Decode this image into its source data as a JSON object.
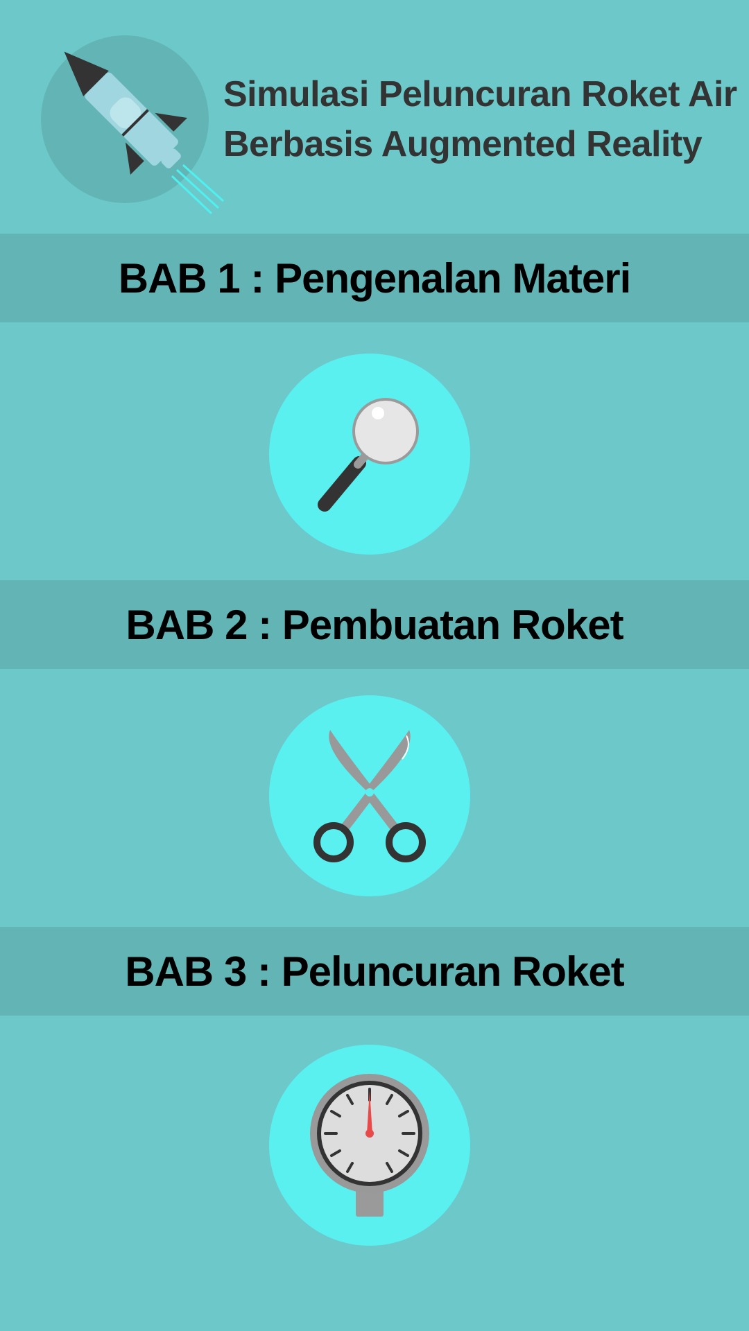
{
  "header": {
    "title_line1": "Simulasi Peluncuran Roket Air",
    "title_line2": "Berbasis Augmented Reality",
    "logo_icon": "water-rocket-icon"
  },
  "chapters": [
    {
      "label": "BAB 1 : Pengenalan Materi",
      "icon": "magnifying-glass-icon"
    },
    {
      "label": "BAB 2 : Pembuatan Roket",
      "icon": "scissors-icon"
    },
    {
      "label": "BAB 3 : Peluncuran Roket",
      "icon": "pressure-gauge-icon"
    }
  ],
  "colors": {
    "background": "#6dc9c9",
    "band": "#63b5b5",
    "icon_circle": "#5af0f0",
    "title_text": "#333333",
    "chapter_text": "#000000",
    "gauge_needle": "#e84a4a"
  }
}
